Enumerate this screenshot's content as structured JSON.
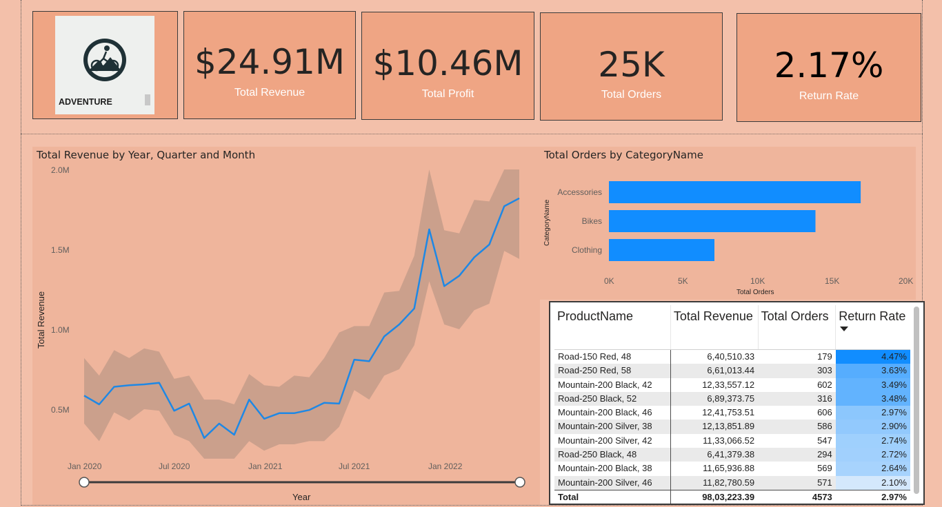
{
  "logo": {
    "text": "ADVENTURE"
  },
  "kpis": [
    {
      "value": "$24.91M",
      "label": "Total Revenue"
    },
    {
      "value": "$10.46M",
      "label": "Total Profit"
    },
    {
      "value": "25K",
      "label": "Total Orders"
    },
    {
      "value": "2.17%",
      "label": "Return Rate"
    }
  ],
  "line_chart": {
    "title": "Total Revenue by Year, Quarter and Month",
    "ylabel": "Total Revenue",
    "xlabel": "Year",
    "y_ticks": [
      "2.0M",
      "1.5M",
      "1.0M",
      "0.5M"
    ],
    "x_ticks": [
      "Jan 2020",
      "Jul 2020",
      "Jan 2021",
      "Jul 2021",
      "Jan 2022"
    ]
  },
  "bar_chart": {
    "title": "Total Orders by CategoryName",
    "ylabel": "CategoryName",
    "xlabel": "Total Orders",
    "x_ticks": [
      "0K",
      "5K",
      "10K",
      "15K",
      "20K"
    ]
  },
  "chart_data": [
    {
      "type": "line",
      "title": "Total Revenue by Year, Quarter and Month",
      "xlabel": "Year",
      "ylabel": "Total Revenue",
      "ylim": [
        0,
        2000000
      ],
      "x": [
        "2020-01",
        "2020-02",
        "2020-03",
        "2020-04",
        "2020-05",
        "2020-06",
        "2020-07",
        "2020-08",
        "2020-09",
        "2020-10",
        "2020-11",
        "2020-12",
        "2021-01",
        "2021-02",
        "2021-03",
        "2021-04",
        "2021-05",
        "2021-06",
        "2021-07",
        "2021-08",
        "2021-09",
        "2021-10",
        "2021-11",
        "2021-12",
        "2022-01",
        "2022-02",
        "2022-03",
        "2022-04",
        "2022-05",
        "2022-06"
      ],
      "series": [
        {
          "color": "#1e88e5",
          "values": [
            585000,
            530000,
            640000,
            650000,
            655000,
            665000,
            490000,
            535000,
            320000,
            410000,
            340000,
            560000,
            440000,
            475000,
            475000,
            495000,
            540000,
            535000,
            810000,
            800000,
            955000,
            1030000,
            1130000,
            1625000,
            1270000,
            1335000,
            1450000,
            1530000,
            1770000,
            1820000
          ]
        }
      ],
      "band": {
        "color": "#c49c8a",
        "upper": [
          820000,
          710000,
          870000,
          820000,
          880000,
          860000,
          690000,
          710000,
          560000,
          560000,
          530000,
          720000,
          650000,
          640000,
          710000,
          700000,
          820000,
          980000,
          1020000,
          1020000,
          1230000,
          1240000,
          1460000,
          2000000,
          1620000,
          1600000,
          1810000,
          1800000,
          2000000,
          2000000
        ],
        "lower": [
          410000,
          300000,
          480000,
          430000,
          500000,
          490000,
          340000,
          300000,
          190000,
          190000,
          190000,
          300000,
          240000,
          280000,
          280000,
          300000,
          300000,
          390000,
          620000,
          560000,
          710000,
          750000,
          900000,
          1300000,
          1030000,
          1000000,
          1120000,
          1160000,
          1490000,
          1440000
        ]
      }
    },
    {
      "type": "bar",
      "title": "Total Orders by CategoryName",
      "categories": [
        "Accessories",
        "Bikes",
        "Clothing"
      ],
      "values": [
        16983,
        13929,
        7114
      ],
      "xlabel": "Total Orders",
      "ylabel": "CategoryName",
      "xlim": [
        0,
        20000
      ],
      "color": "#118dff"
    }
  ],
  "table": {
    "headers": [
      "ProductName",
      "Total Revenue",
      "Total Orders",
      "Return Rate"
    ],
    "rows": [
      {
        "product": "Road-150 Red, 48",
        "revenue": "6,40,510.33",
        "orders": "179",
        "rate": "4.47%",
        "rate_value": 4.47
      },
      {
        "product": "Road-250 Red, 58",
        "revenue": "6,61,013.44",
        "orders": "303",
        "rate": "3.63%",
        "rate_value": 3.63
      },
      {
        "product": "Mountain-200 Black, 42",
        "revenue": "12,33,557.12",
        "orders": "602",
        "rate": "3.49%",
        "rate_value": 3.49
      },
      {
        "product": "Road-250 Black, 52",
        "revenue": "6,89,373.75",
        "orders": "316",
        "rate": "3.48%",
        "rate_value": 3.48
      },
      {
        "product": "Mountain-200 Black, 46",
        "revenue": "12,41,753.51",
        "orders": "606",
        "rate": "2.97%",
        "rate_value": 2.97
      },
      {
        "product": "Mountain-200 Silver, 38",
        "revenue": "12,13,851.89",
        "orders": "586",
        "rate": "2.90%",
        "rate_value": 2.9
      },
      {
        "product": "Mountain-200 Silver, 42",
        "revenue": "11,33,066.52",
        "orders": "547",
        "rate": "2.74%",
        "rate_value": 2.74
      },
      {
        "product": "Road-250 Black, 48",
        "revenue": "6,41,379.38",
        "orders": "294",
        "rate": "2.72%",
        "rate_value": 2.72
      },
      {
        "product": "Mountain-200 Black, 38",
        "revenue": "11,65,936.88",
        "orders": "569",
        "rate": "2.64%",
        "rate_value": 2.64
      },
      {
        "product": "Mountain-200 Silver, 46",
        "revenue": "11,82,780.59",
        "orders": "571",
        "rate": "2.10%",
        "rate_value": 2.1
      }
    ],
    "total": {
      "label": "Total",
      "revenue": "98,03,223.39",
      "orders": "4573",
      "rate": "2.97%"
    }
  }
}
